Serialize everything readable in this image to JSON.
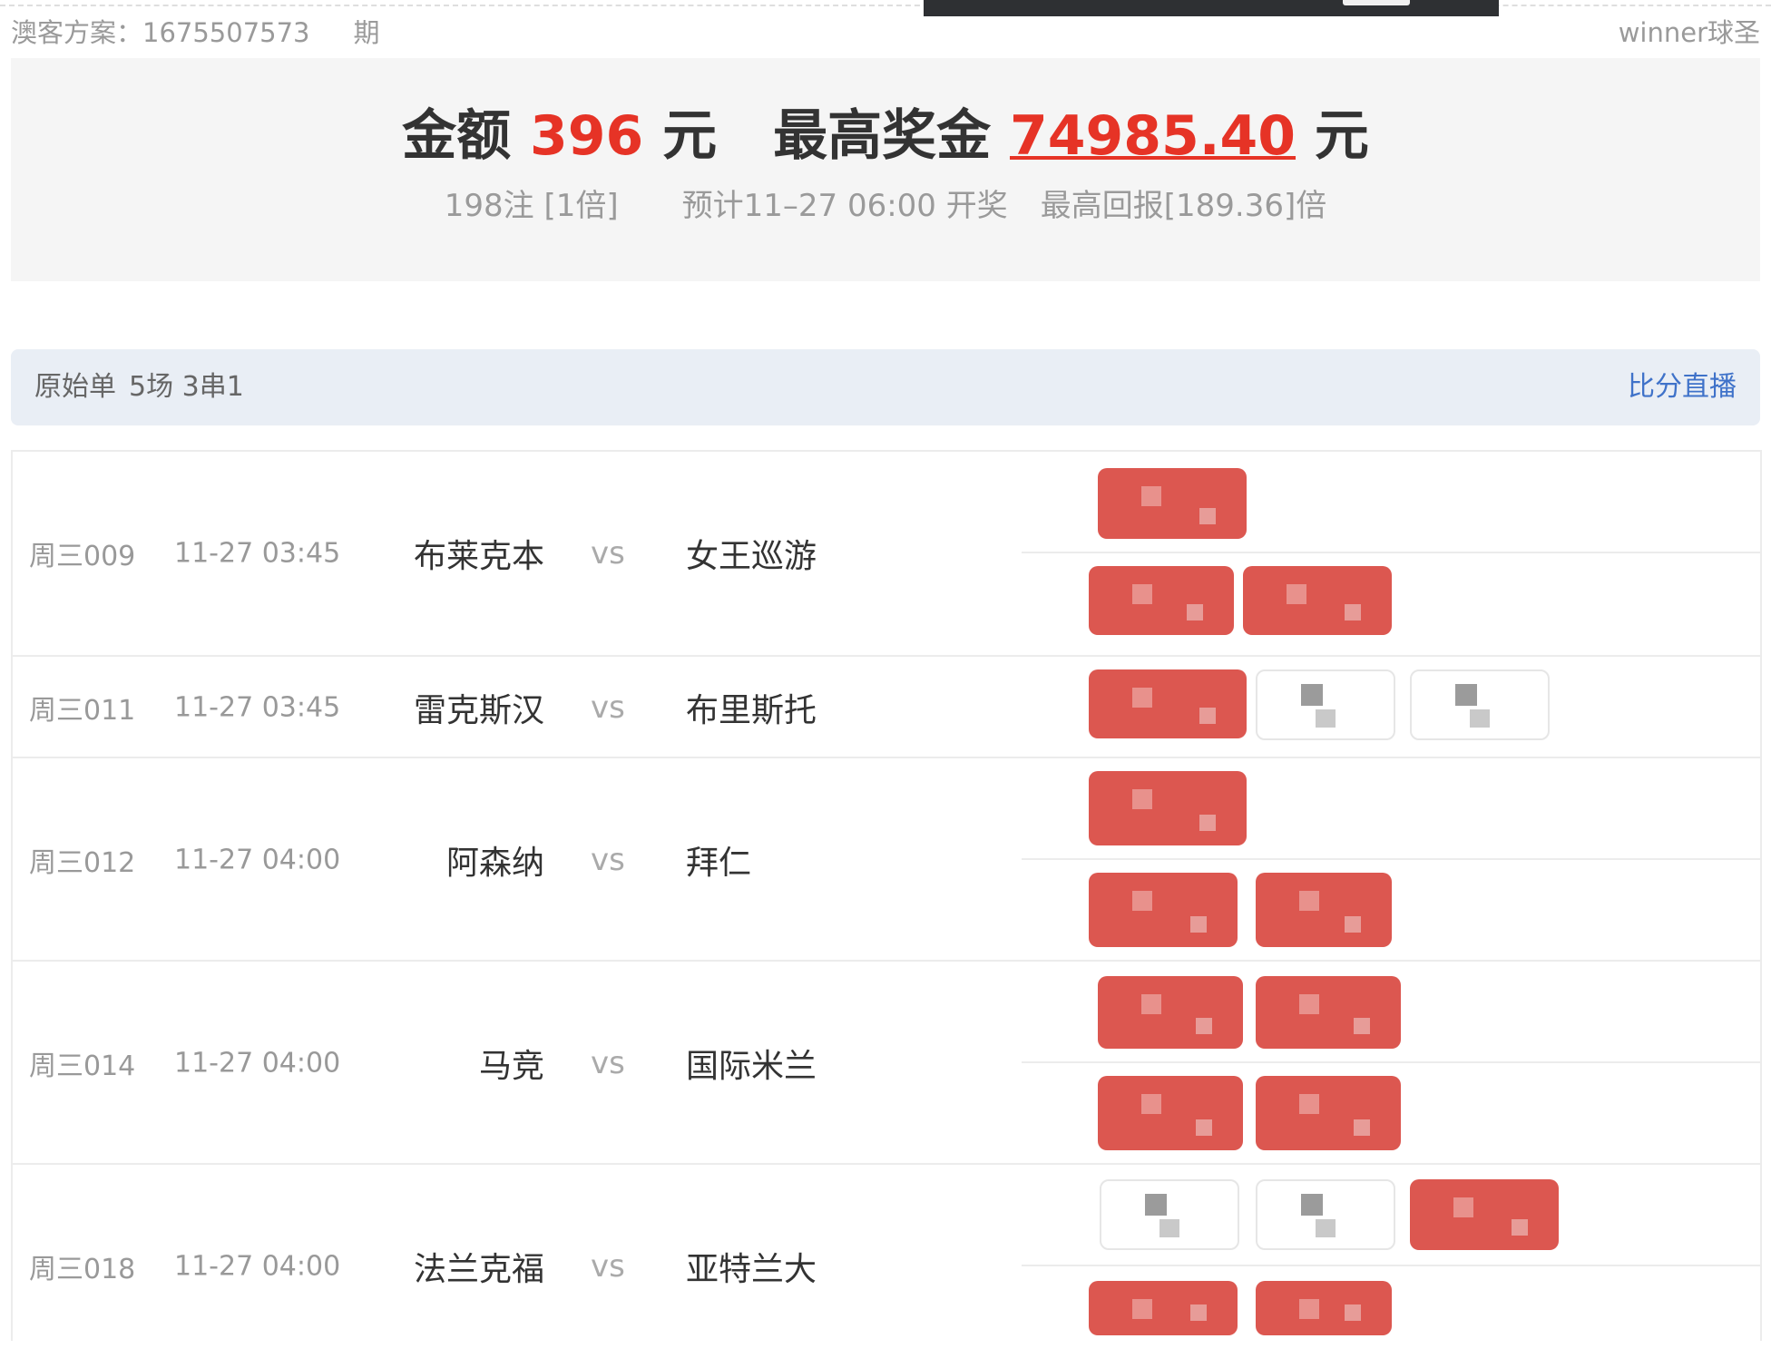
{
  "header": {
    "plan_label": "澳客方案：1675507573",
    "issue_label": "期",
    "brand": "winner球圣"
  },
  "summary": {
    "amount_label": "金额",
    "amount_value": "396",
    "amount_unit": "元",
    "max_prize_label": "最高奖金",
    "max_prize_value": "74985.40",
    "max_prize_unit": "元",
    "bets": "198注 [1倍]",
    "draw_time": "预计11–27 06:00 开奖",
    "max_return": "最高回报[189.36]倍"
  },
  "panel": {
    "title": "原始单",
    "detail": "5场 3串1",
    "live_link": "比分直播"
  },
  "matches": [
    {
      "no": "周三009",
      "time": "11-27 03:45",
      "home": "布莱克本",
      "vs": "vs",
      "away": "女王巡游"
    },
    {
      "no": "周三011",
      "time": "11-27 03:45",
      "home": "雷克斯汉",
      "vs": "vs",
      "away": "布里斯托"
    },
    {
      "no": "周三012",
      "time": "11-27 04:00",
      "home": "阿森纳",
      "vs": "vs",
      "away": "拜仁"
    },
    {
      "no": "周三014",
      "time": "11-27 04:00",
      "home": "马竞",
      "vs": "vs",
      "away": "国际米兰"
    },
    {
      "no": "周三018",
      "time": "11-27 04:00",
      "home": "法兰克福",
      "vs": "vs",
      "away": "亚特兰大"
    }
  ],
  "colors": {
    "accent_red": "#e63326",
    "link_blue": "#3f72c9",
    "selected_pick": "#dc5750"
  }
}
